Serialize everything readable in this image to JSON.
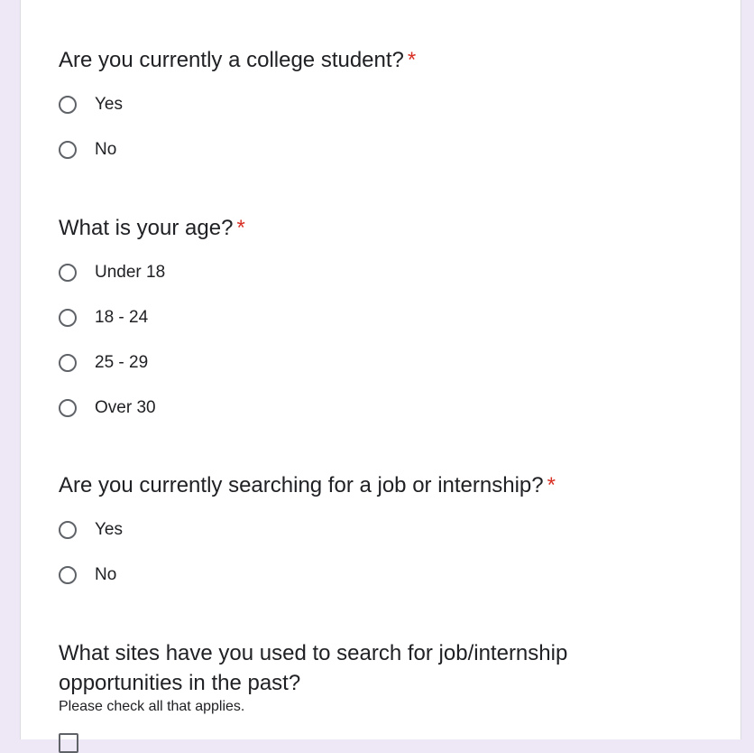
{
  "questions": [
    {
      "title": "Are you currently a college student?",
      "required_mark": "*",
      "options": [
        "Yes",
        "No"
      ]
    },
    {
      "title": "What is your age?",
      "required_mark": "*",
      "options": [
        "Under 18",
        "18 - 24",
        "25 - 29",
        "Over 30"
      ]
    },
    {
      "title": "Are you currently searching for a job or internship?",
      "required_mark": "*",
      "options": [
        "Yes",
        "No"
      ]
    },
    {
      "title": "What sites have you used to search for job/internship opportunities in the past?",
      "description": "Please check all that applies."
    }
  ],
  "colors": {
    "page_background": "#ede7f6",
    "required": "#d93025",
    "text": "#202124",
    "control_border": "#5f6368"
  }
}
